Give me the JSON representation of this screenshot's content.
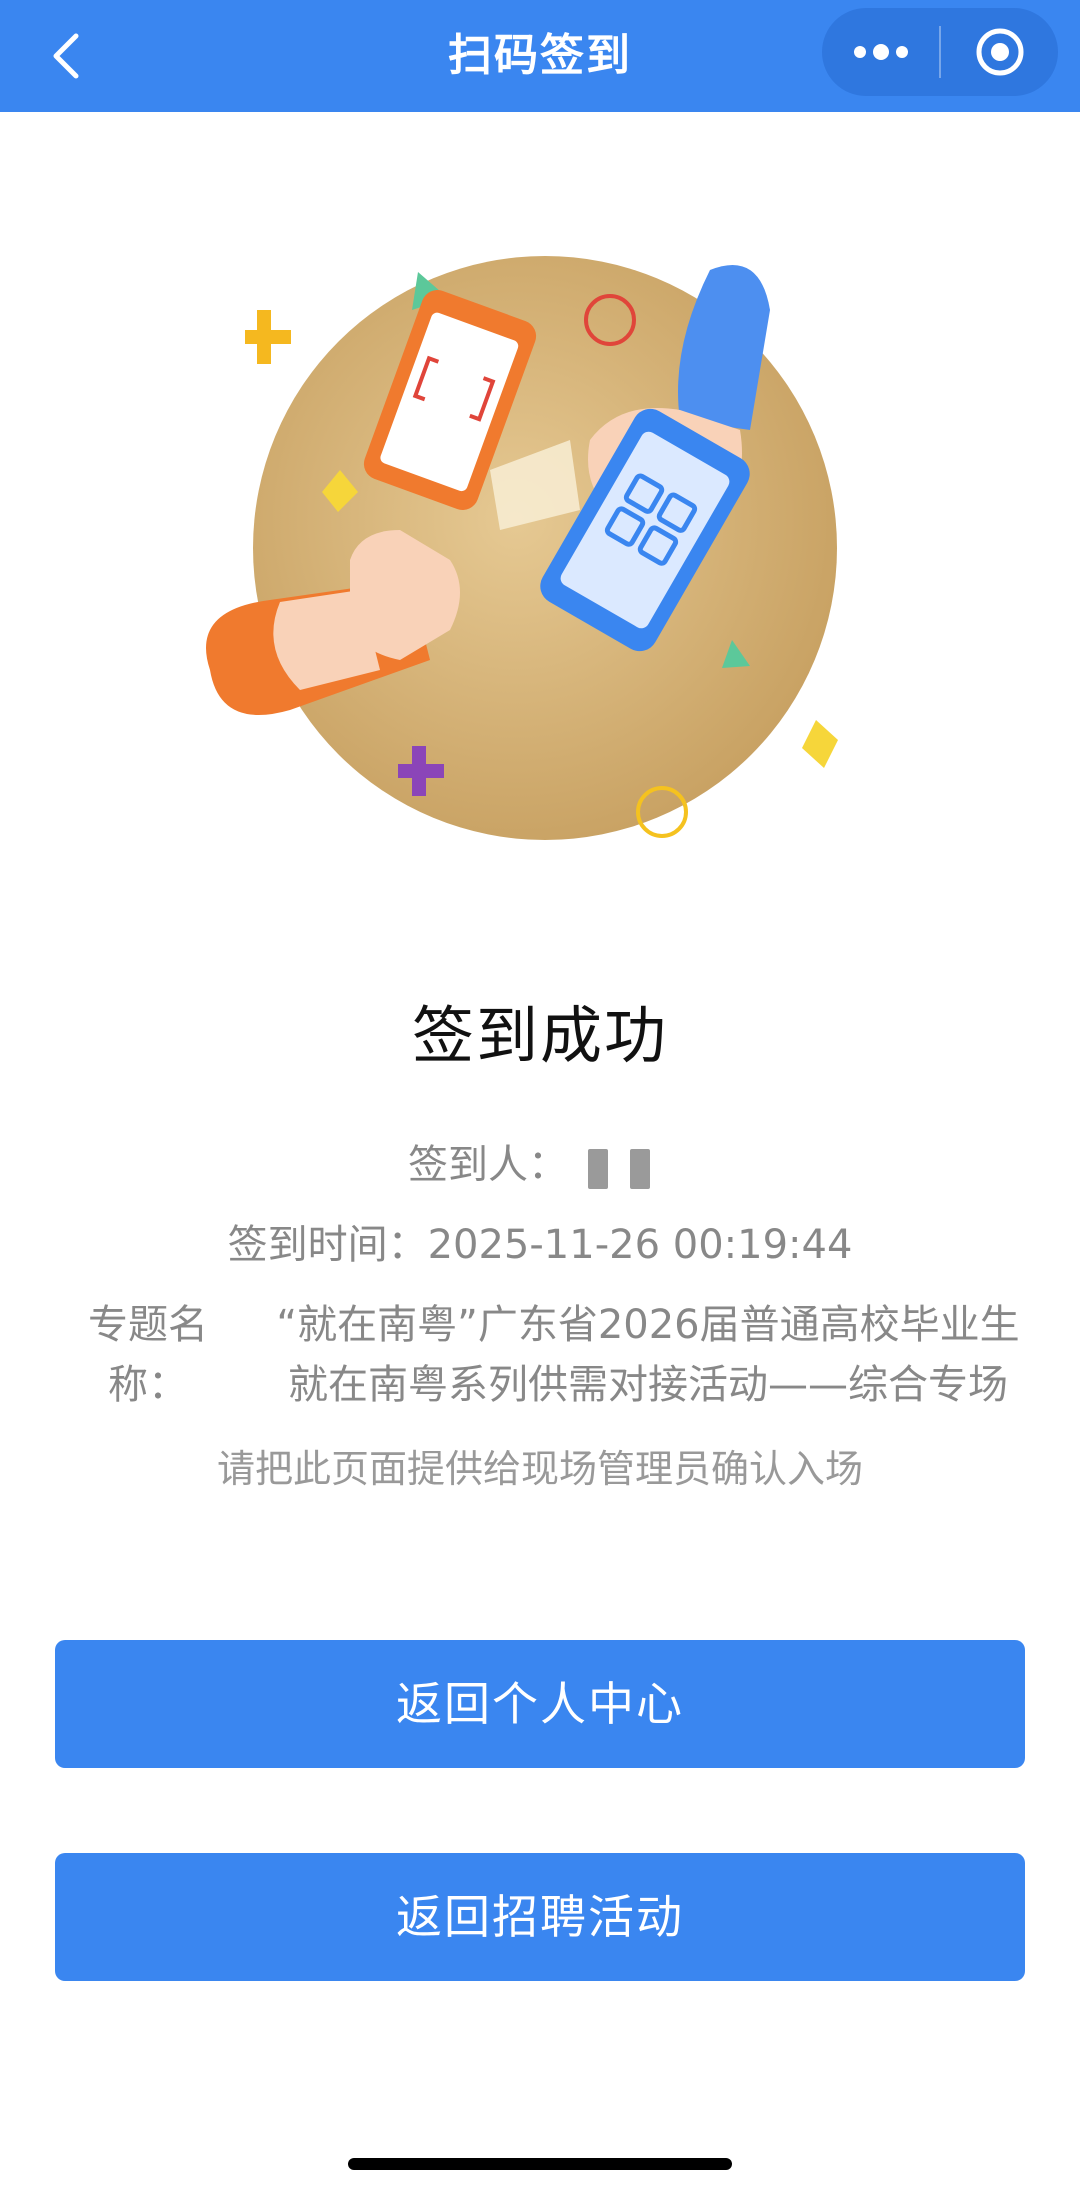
{
  "nav": {
    "title": "扫码签到",
    "back_icon": "chevron-left-icon",
    "more_icon": "more-dots-icon",
    "close_icon": "target-circle-icon",
    "bar_color": "#3a86f0"
  },
  "result": {
    "title": "签到成功",
    "signer_label": "签到人：",
    "time_label": "签到时间：",
    "time_value": "2025-11-26 00:19:44",
    "topic_label": "专题名称：",
    "topic_value": "“就在南粤”广东省2026届普通高校毕业生就在南粤系列供需对接活动——综合专场",
    "hint": "请把此页面提供给现场管理员确认入场"
  },
  "buttons": {
    "personal_center": "返回个人中心",
    "recruit_activity": "返回招聘活动"
  },
  "colors": {
    "accent": "#3a86f0",
    "text_primary": "#111111",
    "text_secondary": "#888888"
  }
}
